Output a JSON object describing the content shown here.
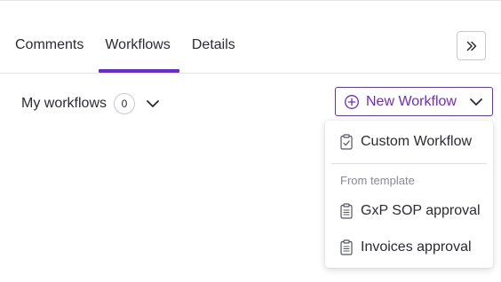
{
  "tabs": [
    {
      "label": "Comments",
      "active": false
    },
    {
      "label": "Workflows",
      "active": true
    },
    {
      "label": "Details",
      "active": false
    }
  ],
  "accent_color": "#6d28d9",
  "expand_button": {
    "icon": "double-chevron-right-icon"
  },
  "my_workflows": {
    "label": "My workflows",
    "count": "0"
  },
  "new_workflow_button": {
    "label": "New Workflow",
    "icon": "plus-circle-icon"
  },
  "dropdown": {
    "custom_item": {
      "label": "Custom Workflow",
      "icon": "clipboard-check-icon"
    },
    "group_label": "From template",
    "template_items": [
      {
        "label": "GxP SOP approval",
        "icon": "clipboard-list-icon"
      },
      {
        "label": "Invoices approval",
        "icon": "clipboard-list-icon"
      }
    ]
  }
}
